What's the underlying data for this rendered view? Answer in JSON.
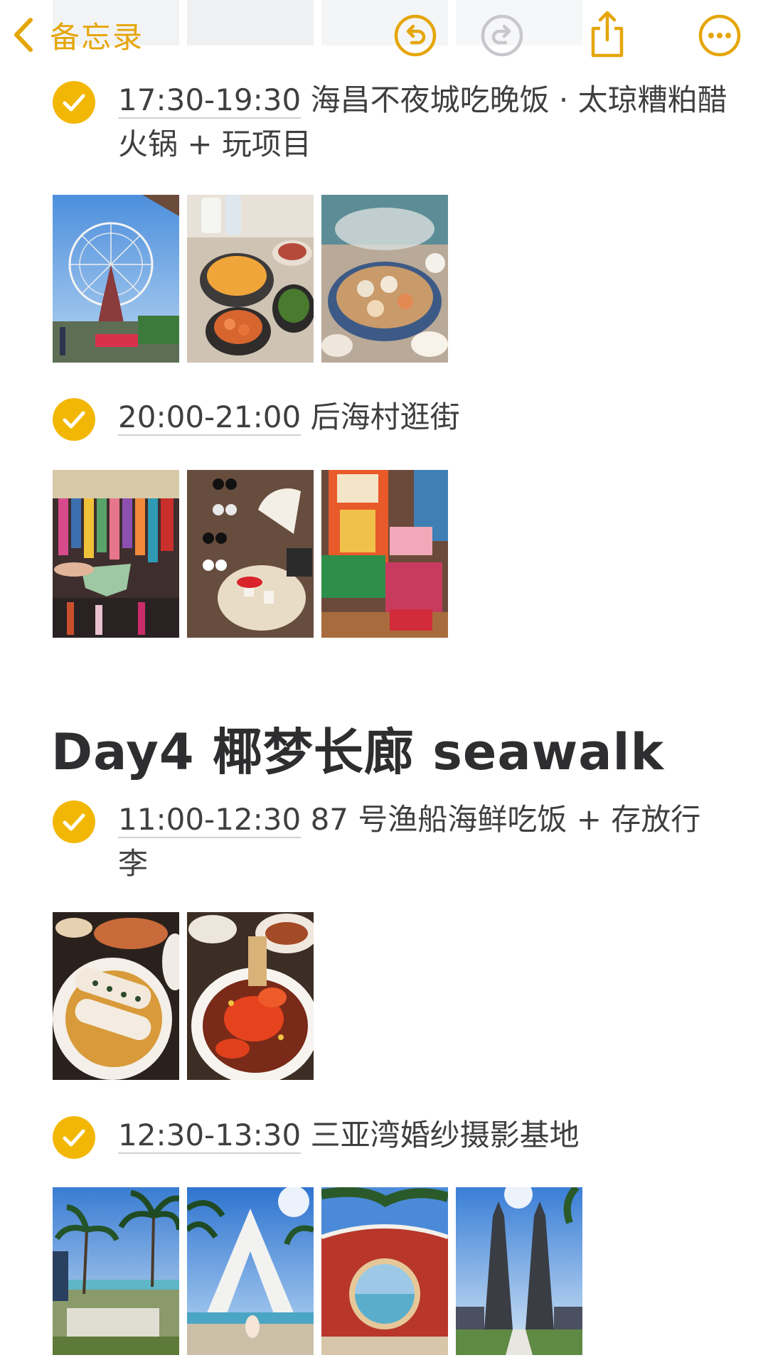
{
  "nav": {
    "back_label": "备忘录",
    "icons": [
      "chevron-left-icon",
      "undo-icon",
      "redo-icon",
      "share-icon",
      "more-icon"
    ],
    "accent_color": "#e5a60a",
    "disabled_color": "#c7c7cc"
  },
  "items": [
    {
      "time": "17:30-19:30",
      "text": " 海昌不夜城吃晚饭 · 太琼糟粕醋火锅 + 玩项目",
      "checked": true
    },
    {
      "time": "20:00-21:00",
      "text": " 后海村逛街",
      "checked": true
    },
    {
      "time": "11:00-12:30",
      "text": " 87 号渔船海鲜吃饭 + 存放行李",
      "checked": true
    },
    {
      "time": "12:30-13:30",
      "text": " 三亚湾婚纱摄影基地",
      "checked": true
    }
  ],
  "section_heading": "Day4 椰梦长廊 seawalk",
  "photo_groups": [
    [
      "ferris-wheel-photo",
      "hotpot-table-photo",
      "hotpot-pot-photo"
    ],
    [
      "swimwear-shop-photo",
      "sunglasses-stall-photo",
      "souvenir-shop-photo"
    ],
    [
      "steamed-rice-roll-photo",
      "chilli-crab-photo"
    ],
    [
      "beach-palms-photo",
      "white-arch-photo",
      "red-moon-gate-photo",
      "stone-gate-photo"
    ]
  ],
  "colors": {
    "check": "#f2b705",
    "text": "#3f3f41",
    "heading": "#2e2e30"
  }
}
